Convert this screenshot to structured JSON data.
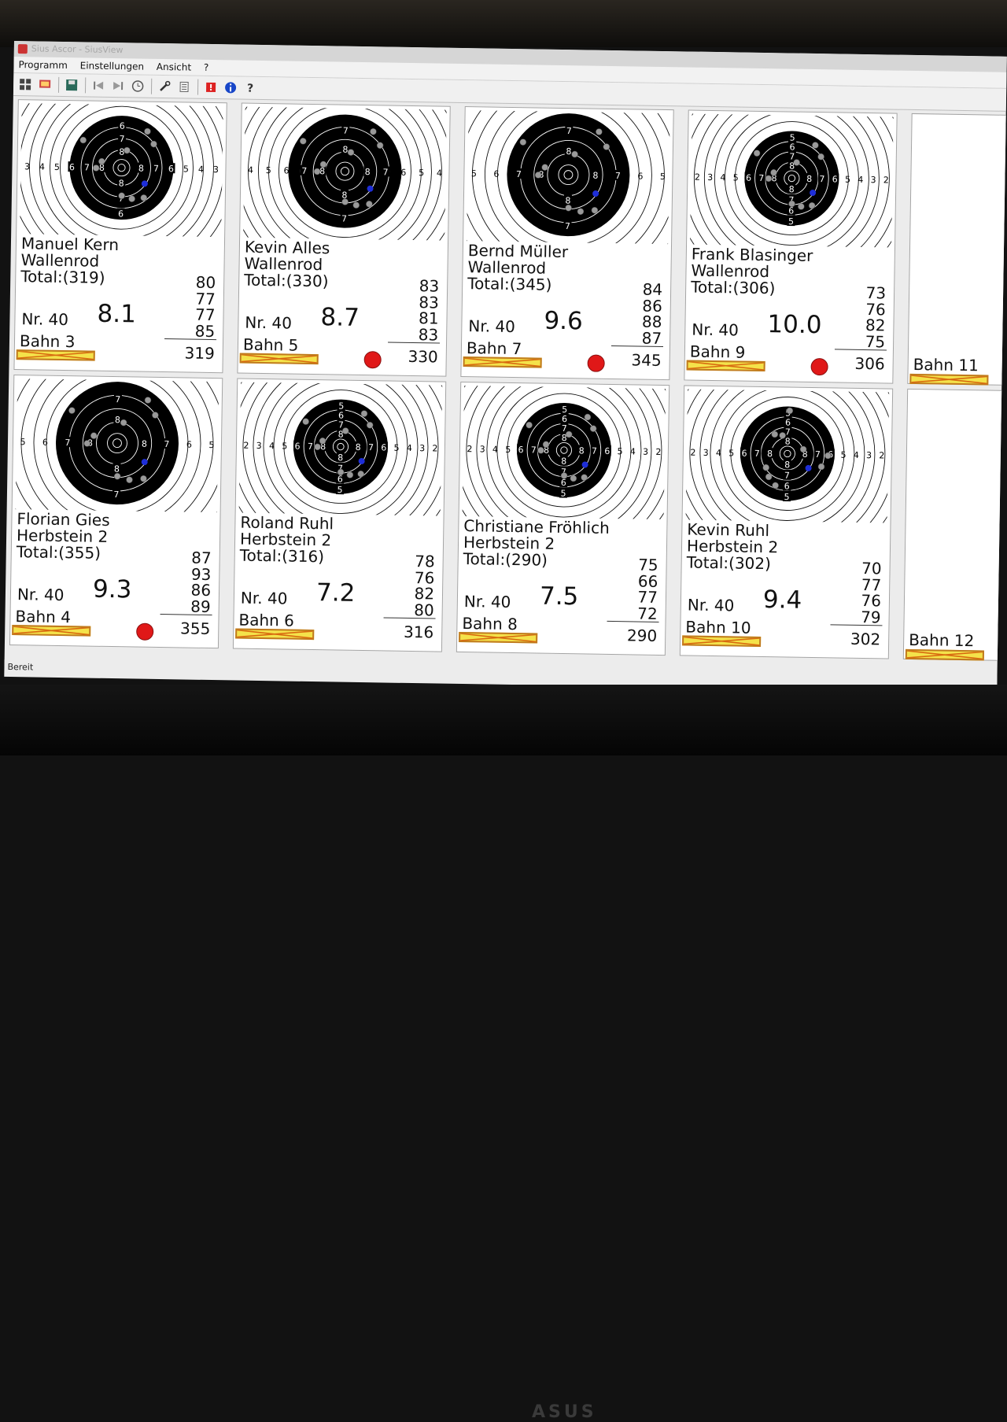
{
  "window": {
    "title": "Sius Ascor - SiusView"
  },
  "menu": [
    "Programm",
    "Einstellungen",
    "Ansicht",
    "?"
  ],
  "toolbar_icons": [
    "grid-view-icon",
    "monitor-icon",
    "save-icon",
    "first-shot-icon",
    "next-shot-icon",
    "clock-icon",
    "wrench-icon",
    "list-icon",
    "alarm-icon",
    "info-icon",
    "help-icon"
  ],
  "status": {
    "text": "Bereit"
  },
  "colors": {
    "flag_fill": "#f4e24a",
    "flag_border": "#c07a1e",
    "flag_cross": "#d86a10",
    "status_dot": "#e01818",
    "target_black": "#000000"
  },
  "cards": [
    {
      "id": "bahn3",
      "name": "Manuel Kern",
      "club": "Wallenrod",
      "total": "Total:(319)",
      "nr": "Nr. 40",
      "last": "8.1",
      "series": [
        "80",
        "77",
        "77",
        "85"
      ],
      "sum": "319",
      "lane": "Bahn 3",
      "status_dot": false,
      "black_rings": 6,
      "left_labels": [
        "3",
        "4",
        "5",
        "6",
        "7",
        "8"
      ],
      "right_labels": [
        "8",
        "7",
        "6",
        "5",
        "4",
        "3"
      ],
      "top_labels": [
        "6",
        "7",
        "8"
      ],
      "bottom_labels": [
        "8",
        "7",
        "6"
      ]
    },
    {
      "id": "bahn5",
      "name": "Kevin Alles",
      "club": "Wallenrod",
      "total": "Total:(330)",
      "nr": "Nr. 40",
      "last": "8.7",
      "series": [
        "83",
        "83",
        "81",
        "83"
      ],
      "sum": "330",
      "lane": "Bahn 5",
      "status_dot": true,
      "black_rings": 7,
      "left_labels": [
        "4",
        "5",
        "6",
        "7",
        "8"
      ],
      "right_labels": [
        "8",
        "7",
        "6",
        "5",
        "4"
      ],
      "top_labels": [
        "7",
        "8"
      ],
      "bottom_labels": [
        "8",
        "7"
      ]
    },
    {
      "id": "bahn7",
      "name": "Bernd Müller",
      "club": "Wallenrod",
      "total": "Total:(345)",
      "nr": "Nr. 40",
      "last": "9.6",
      "series": [
        "84",
        "86",
        "88",
        "87"
      ],
      "sum": "345",
      "lane": "Bahn 7",
      "status_dot": true,
      "black_rings": 8,
      "left_labels": [
        "5",
        "6",
        "7",
        "8"
      ],
      "right_labels": [
        "8",
        "7",
        "6",
        "5"
      ],
      "top_labels": [
        "7",
        "8"
      ],
      "bottom_labels": [
        "8",
        "7"
      ]
    },
    {
      "id": "bahn9",
      "name": "Frank Blasinger",
      "club": "Wallenrod",
      "total": "Total:(306)",
      "nr": "Nr. 40",
      "last": "10.0",
      "series": [
        "73",
        "76",
        "82",
        "75"
      ],
      "sum": "306",
      "lane": "Bahn 9",
      "status_dot": true,
      "black_rings": 5,
      "left_labels": [
        "2",
        "3",
        "4",
        "5",
        "6",
        "7",
        "8"
      ],
      "right_labels": [
        "8",
        "7",
        "6",
        "5",
        "4",
        "3",
        "2"
      ],
      "top_labels": [
        "5",
        "6",
        "7",
        "8"
      ],
      "bottom_labels": [
        "8",
        "7",
        "6",
        "5"
      ]
    },
    {
      "id": "bahn11",
      "name": "",
      "club": "",
      "total": "",
      "nr": "",
      "last": "",
      "series": [],
      "sum": "",
      "lane": "Bahn 11",
      "status_dot": false,
      "black_rings": 0
    },
    {
      "id": "bahn4",
      "name": "Florian Gies",
      "club": "Herbstein 2",
      "total": "Total:(355)",
      "nr": "Nr. 40",
      "last": "9.3",
      "series": [
        "87",
        "93",
        "86",
        "89"
      ],
      "sum": "355",
      "lane": "Bahn 4",
      "status_dot": true,
      "black_rings": 8,
      "left_labels": [
        "5",
        "6",
        "7",
        "8"
      ],
      "right_labels": [
        "8",
        "7",
        "6",
        "5"
      ],
      "top_labels": [
        "7",
        "8"
      ],
      "bottom_labels": [
        "8",
        "7"
      ]
    },
    {
      "id": "bahn6",
      "name": "Roland Ruhl",
      "club": "Herbstein 2",
      "total": "Total:(316)",
      "nr": "Nr. 40",
      "last": "7.2",
      "series": [
        "78",
        "76",
        "82",
        "80"
      ],
      "sum": "316",
      "lane": "Bahn 6",
      "status_dot": false,
      "black_rings": 5,
      "left_labels": [
        "2",
        "3",
        "4",
        "5",
        "6",
        "7",
        "8"
      ],
      "right_labels": [
        "8",
        "7",
        "6",
        "5",
        "4",
        "3",
        "2"
      ],
      "top_labels": [
        "5",
        "6",
        "7",
        "8"
      ],
      "bottom_labels": [
        "8",
        "7",
        "6",
        "5"
      ]
    },
    {
      "id": "bahn8",
      "name": "Christiane Fröhlich",
      "club": "Herbstein 2",
      "total": "Total:(290)",
      "nr": "Nr. 40",
      "last": "7.5",
      "series": [
        "75",
        "66",
        "77",
        "72"
      ],
      "sum": "290",
      "lane": "Bahn 8",
      "status_dot": false,
      "black_rings": 5,
      "left_labels": [
        "2",
        "3",
        "4",
        "5",
        "6",
        "7",
        "8"
      ],
      "right_labels": [
        "8",
        "7",
        "6",
        "5",
        "4",
        "3",
        "2"
      ],
      "top_labels": [
        "5",
        "6",
        "7",
        "8"
      ],
      "bottom_labels": [
        "8",
        "7",
        "6",
        "5"
      ]
    },
    {
      "id": "bahn10",
      "name": "Kevin Ruhl",
      "club": "Herbstein 2",
      "total": "Total:(302)",
      "nr": "Nr. 40",
      "last": "9.4",
      "series": [
        "70",
        "77",
        "76",
        "79"
      ],
      "sum": "302",
      "lane": "Bahn 10",
      "status_dot": false,
      "black_rings": 5,
      "left_labels": [
        "2",
        "3",
        "4",
        "5",
        "6",
        "7",
        "8"
      ],
      "right_labels": [
        "8",
        "7",
        "6",
        "5",
        "4",
        "3",
        "2"
      ],
      "top_labels": [
        "5",
        "6",
        "7",
        "8"
      ],
      "bottom_labels": [
        "8",
        "7",
        "6",
        "5"
      ]
    },
    {
      "id": "bahn12",
      "name": "",
      "club": "",
      "total": "",
      "nr": "",
      "last": "",
      "series": [],
      "sum": "",
      "lane": "Bahn 12",
      "status_dot": false,
      "black_rings": 0
    }
  ]
}
